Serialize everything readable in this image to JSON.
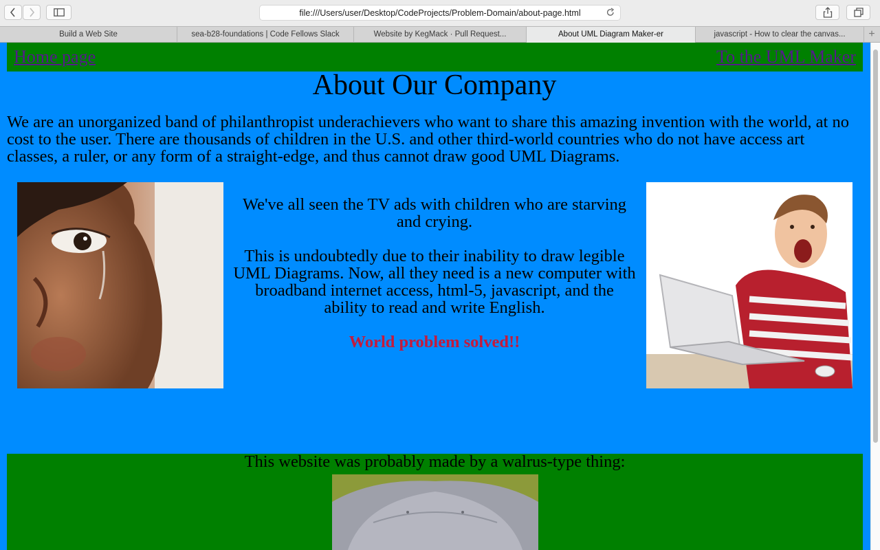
{
  "browser": {
    "url": "file:///Users/user/Desktop/CodeProjects/Problem-Domain/about-page.html",
    "tabs": [
      {
        "label": "Build a Web Site"
      },
      {
        "label": "sea-b28-foundations | Code Fellows Slack"
      },
      {
        "label": "Website by KegMack · Pull Request..."
      },
      {
        "label": "About UML Diagram Maker-er"
      },
      {
        "label": "javascript - How to clear the canvas..."
      }
    ],
    "active_tab": 3
  },
  "page": {
    "nav": {
      "home": "Home page",
      "uml": "To the UML Maker"
    },
    "title": "About Our Company",
    "intro": "We are an unorganized band of philanthropist underachievers who want to share this amazing invention with the world, at no cost to the user. There are thousands of children in the U.S. and other third-world countries who do not have access art classes, a ruler, or any form of a straight-edge, and thus cannot draw good UML Diagrams.",
    "middle": {
      "p1": "We've all seen the TV ads with children who are starving and crying.",
      "p2": "This is undoubtedly due to their inability to draw legible UML Diagrams. Now, all they need is a new computer with broadband internet access, html-5, javascript, and the ability to read and write English.",
      "p3": "World problem solved!!"
    },
    "footer": {
      "text": "This website was probably made by a walrus-type thing:"
    }
  },
  "colors": {
    "page_bg": "#008cff",
    "nav_bg": "#008000",
    "link": "#551a8b",
    "highlight": "#c41a3c"
  }
}
